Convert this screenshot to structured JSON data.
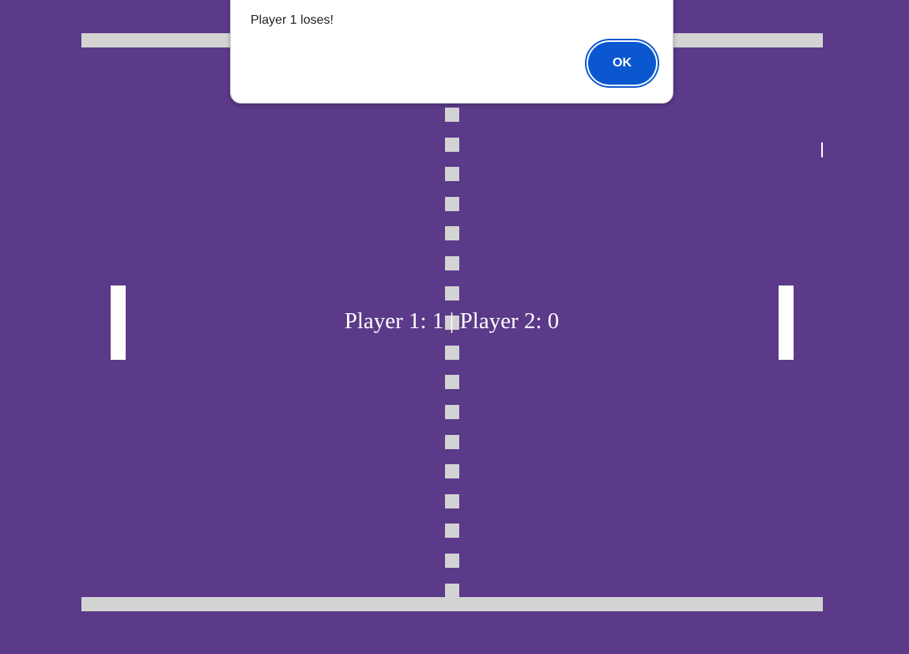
{
  "alert": {
    "message": "Player 1 loses!",
    "ok_label": "OK"
  },
  "game": {
    "score_text": "Player 1: 1 | Player 2: 0",
    "player1_score": 1,
    "player2_score": 0
  },
  "colors": {
    "background": "#5b3a89",
    "walls": "#d3d3d3",
    "paddles": "#ffffff",
    "ok_button": "#0b57d0"
  }
}
